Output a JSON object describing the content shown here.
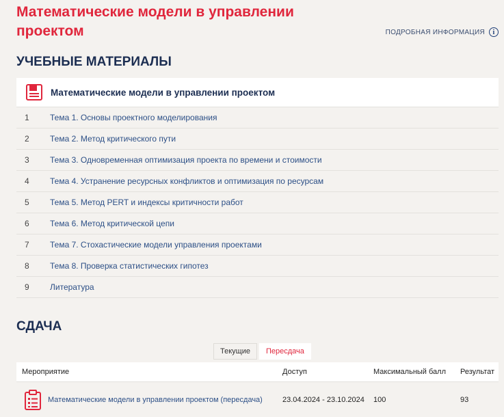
{
  "header": {
    "title": "Математические модели в управлении проектом",
    "info_link": "ПОДРОБНАЯ ИНФОРМАЦИЯ"
  },
  "materials": {
    "section_title": "УЧЕБНЫЕ МАТЕРИАЛЫ",
    "panel_title": "Математические модели в управлении проектом",
    "topics": [
      {
        "num": "1",
        "label": "Тема 1. Основы проектного моделирования"
      },
      {
        "num": "2",
        "label": "Тема 2. Метод критического пути"
      },
      {
        "num": "3",
        "label": "Тема 3. Одновременная оптимизация проекта по времени и стоимости"
      },
      {
        "num": "4",
        "label": "Тема 4. Устранение ресурсных конфликтов и оптимизация по ресурсам"
      },
      {
        "num": "5",
        "label": "Тема 5. Метод PERT и индексы критичности работ"
      },
      {
        "num": "6",
        "label": "Тема 6. Метод критической цепи"
      },
      {
        "num": "7",
        "label": "Тема 7. Стохастические модели управления проектами"
      },
      {
        "num": "8",
        "label": "Тема 8. Проверка статистических гипотез"
      },
      {
        "num": "9",
        "label": "Литература"
      }
    ]
  },
  "submission": {
    "section_title": "СДАЧА",
    "tabs": [
      {
        "label": "Текущие",
        "active": false
      },
      {
        "label": "Пересдача",
        "active": true
      }
    ],
    "columns": [
      "Мероприятие",
      "Доступ",
      "Максимальный балл",
      "Результат"
    ],
    "rows": [
      {
        "event": "Математические модели в управлении проектом (пересдача)",
        "access": "23.04.2024 - 23.10.2024",
        "max_score": "100",
        "result": "93"
      }
    ]
  },
  "colors": {
    "accent": "#e0263c",
    "link": "#2c4f86",
    "heading": "#1c2e52"
  }
}
